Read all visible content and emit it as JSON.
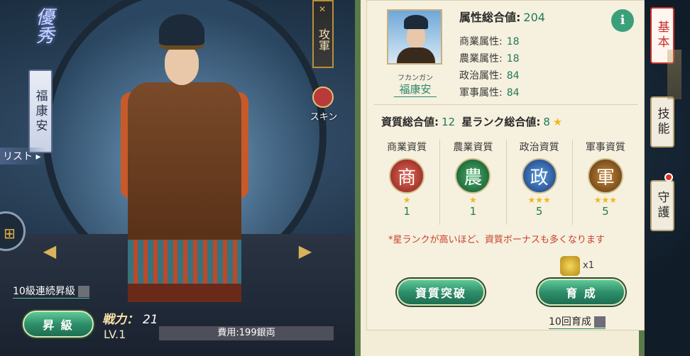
{
  "title_deco": "優秀",
  "hero": {
    "name_vertical": "福康安",
    "list_link": "リスト",
    "strength_label": "戦力：",
    "strength_value": "21",
    "level": "LV.1",
    "cost": "費用:199銀両",
    "ten_level_label": "10級連続昇級",
    "promote_label": "昇 級"
  },
  "attack_tab": "攻軍",
  "skin_label": "スキン",
  "panel": {
    "furigana": "フカンガン",
    "name": "福康安",
    "attr_total_label": "属性総合値:",
    "attr_total_value": "204",
    "attrs": [
      {
        "label": "商業属性:",
        "value": "18"
      },
      {
        "label": "農業属性:",
        "value": "18"
      },
      {
        "label": "政治属性:",
        "value": "84"
      },
      {
        "label": "軍事属性:",
        "value": "84"
      }
    ],
    "quality_label": "資質総合値:",
    "quality_value": "12",
    "star_label": "星ランク総合値:",
    "star_value": "8",
    "aptitudes": [
      {
        "label": "商業資質",
        "glyph": "商",
        "stars": "★",
        "value": "1"
      },
      {
        "label": "農業資質",
        "glyph": "農",
        "stars": "★",
        "value": "1"
      },
      {
        "label": "政治資質",
        "glyph": "政",
        "stars": "★★★",
        "value": "5"
      },
      {
        "label": "軍事資質",
        "glyph": "軍",
        "stars": "★★★",
        "value": "5"
      }
    ],
    "note": "*星ランクが高いほど、資質ボーナスも多くなります",
    "item_count": "x1",
    "break_label": "資質突破",
    "train_label": "育 成",
    "ten_train_label": "10回育成"
  },
  "tabs": {
    "basic": "基本",
    "skill": "技能",
    "guard": "守護"
  },
  "colors": {
    "accent_green": "#1e7a5a",
    "button_green": "#2f8f6a",
    "note_red": "#c8402a",
    "star_gold": "#f0b820"
  }
}
